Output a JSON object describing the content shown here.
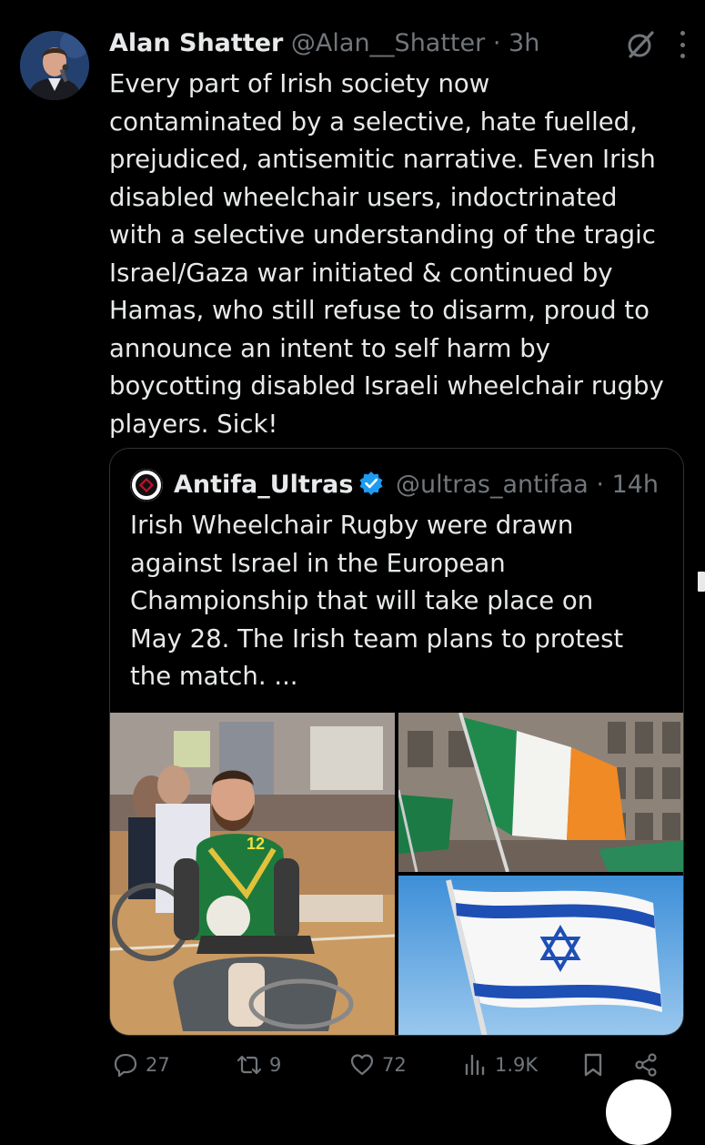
{
  "tweet": {
    "author_name": "Alan Shatter",
    "author_handle": "@Alan__Shatter",
    "separator": "·",
    "time": "3h",
    "text": "Every part of Irish society now\ncontaminated by a selective, hate fuelled,\nprejudiced, antisemitic narrative. Even Irish\ndisabled wheelchair users, indoctrinated\nwith a selective understanding of the tragic\nIsrael/Gaza war initiated & continued by\nHamas, who still refuse to disarm, proud to\nannounce an intent to self harm by\nboycotting disabled Israeli wheelchair rugby\nplayers. Sick!"
  },
  "quote": {
    "author_name": "Antifa_Ultras",
    "author_handle": "@ultras_antifaa",
    "separator": "·",
    "time": "14h",
    "text": "Irish Wheelchair Rugby were drawn\nagainst Israel in the European\nChampionship that will take place on\nMay 28. The Irish team plans to protest\nthe match. ...",
    "player_number": "12"
  },
  "actions": {
    "replies": "27",
    "reposts": "9",
    "likes": "72",
    "views": "1.9K"
  },
  "icons": {
    "grok": "grok-icon",
    "more": "more-icon",
    "verified": "verified-badge-icon",
    "reply": "reply-icon",
    "repost": "repost-icon",
    "like": "heart-icon",
    "views": "views-icon",
    "bookmark": "bookmark-icon",
    "share": "share-icon"
  },
  "colors": {
    "background": "#000000",
    "text": "#e7e9ea",
    "secondary": "#71767b",
    "verified": "#1d9bf0",
    "border": "#2f3336"
  }
}
